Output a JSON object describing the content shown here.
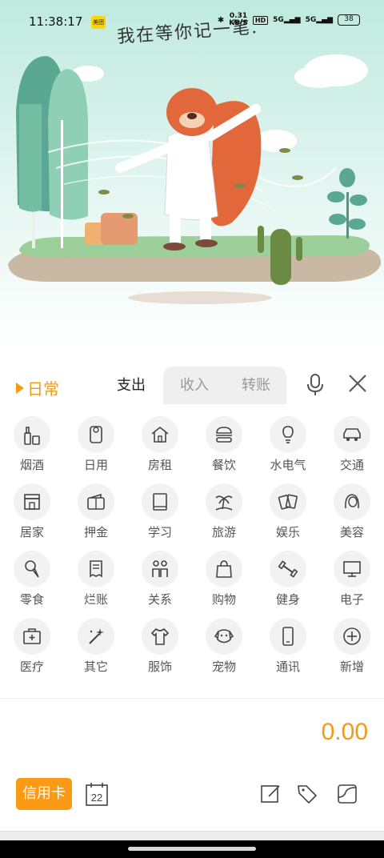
{
  "status_bar": {
    "time": "11:38:17",
    "app_badge": "美团",
    "speed_value": "0.31",
    "speed_unit": "KB/S",
    "hd": "HD",
    "signal_1": "5G",
    "signal_2": "5G",
    "battery": "38"
  },
  "banner": {
    "caption": "我在等你记一笔."
  },
  "tabs": {
    "ledger": "日常",
    "expense": "支出",
    "income": "收入",
    "transfer": "转账"
  },
  "categories": [
    {
      "label": "烟酒",
      "icon": "liquor-bottle-icon"
    },
    {
      "label": "日用",
      "icon": "tissue-roll-icon"
    },
    {
      "label": "房租",
      "icon": "house-icon"
    },
    {
      "label": "餐饮",
      "icon": "burger-icon"
    },
    {
      "label": "水电气",
      "icon": "light-bulb-icon"
    },
    {
      "label": "交通",
      "icon": "car-icon"
    },
    {
      "label": "居家",
      "icon": "storefront-icon"
    },
    {
      "label": "押金",
      "icon": "wallet-icon"
    },
    {
      "label": "学习",
      "icon": "book-icon"
    },
    {
      "label": "旅游",
      "icon": "palm-island-icon"
    },
    {
      "label": "娱乐",
      "icon": "playing-cards-icon"
    },
    {
      "label": "美容",
      "icon": "woman-face-icon"
    },
    {
      "label": "零食",
      "icon": "ice-cream-icon"
    },
    {
      "label": "烂账",
      "icon": "receipt-icon"
    },
    {
      "label": "关系",
      "icon": "people-icon"
    },
    {
      "label": "购物",
      "icon": "shopping-bag-icon"
    },
    {
      "label": "健身",
      "icon": "dumbbell-icon"
    },
    {
      "label": "电子",
      "icon": "monitor-icon"
    },
    {
      "label": "医疗",
      "icon": "medical-kit-icon"
    },
    {
      "label": "其它",
      "icon": "magic-wand-icon"
    },
    {
      "label": "服饰",
      "icon": "shirt-icon"
    },
    {
      "label": "宠物",
      "icon": "dog-face-icon"
    },
    {
      "label": "通讯",
      "icon": "phone-icon"
    },
    {
      "label": "新增",
      "icon": "add-circle-icon"
    }
  ],
  "amount": "0.00",
  "bottom": {
    "account_label": "信用卡",
    "calendar_day": "22"
  },
  "colors": {
    "accent": "#f59a14",
    "button": "#fb9a15",
    "sky": "#cdeee6"
  }
}
